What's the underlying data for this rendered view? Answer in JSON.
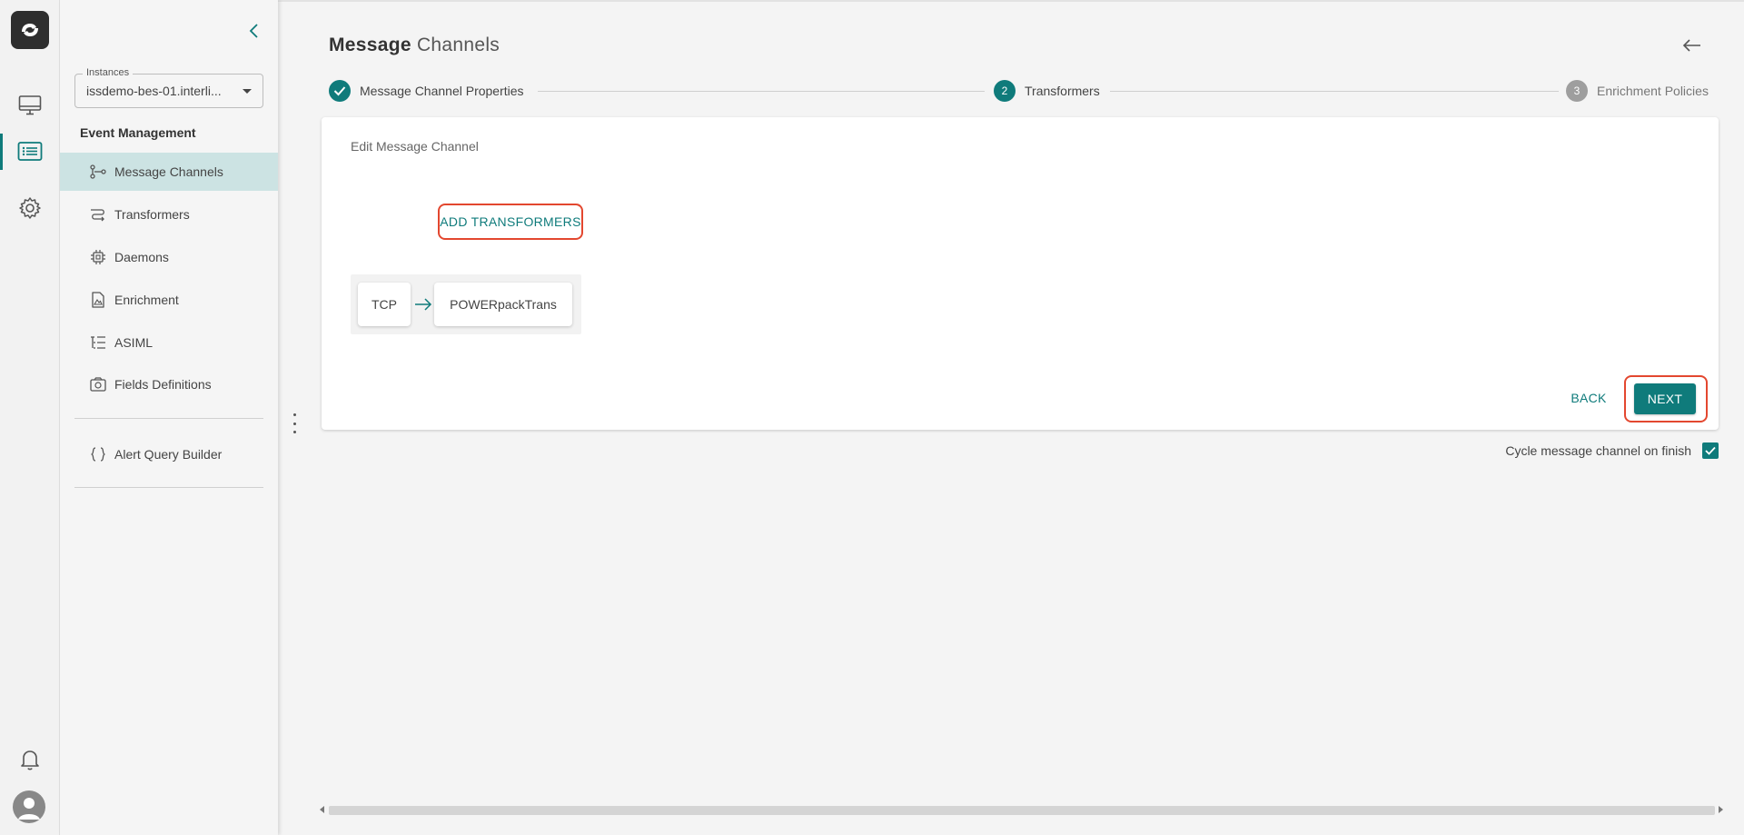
{
  "app": {
    "instance_label": "Instances",
    "instance_value": "issdemo-bes-01.interli..."
  },
  "sidebar": {
    "section_title": "Event Management",
    "items": [
      {
        "label": "Message Channels",
        "icon": "message-channels-icon",
        "active": true
      },
      {
        "label": "Transformers",
        "icon": "transformers-icon",
        "active": false
      },
      {
        "label": "Daemons",
        "icon": "daemons-icon",
        "active": false
      },
      {
        "label": "Enrichment",
        "icon": "enrichment-icon",
        "active": false
      },
      {
        "label": "ASIML",
        "icon": "asiml-icon",
        "active": false
      },
      {
        "label": "Fields Definitions",
        "icon": "fields-definitions-icon",
        "active": false
      }
    ],
    "extra_item": {
      "label": "Alert Query Builder",
      "icon": "braces-icon"
    }
  },
  "rail": {
    "items": [
      "monitor-icon",
      "list-icon",
      "gear-icon"
    ],
    "active": "list-icon",
    "bottom": [
      "bell-icon",
      "avatar"
    ]
  },
  "header": {
    "title_bold": "Message",
    "title_light": "Channels"
  },
  "stepper": {
    "steps": [
      {
        "number": "1",
        "label": "Message Channel Properties",
        "state": "completed"
      },
      {
        "number": "2",
        "label": "Transformers",
        "state": "active"
      },
      {
        "number": "3",
        "label": "Enrichment Policies",
        "state": "pending"
      }
    ]
  },
  "card": {
    "title": "Edit Message Channel",
    "add_button": "ADD TRANSFORMERS",
    "pipeline": [
      "TCP",
      "POWERpackTrans"
    ],
    "back_button": "BACK",
    "next_button": "NEXT"
  },
  "cycle": {
    "label": "Cycle message channel on finish",
    "checked": true
  },
  "colors": {
    "accent": "#0f7b7b",
    "highlight": "#e3472f",
    "active_nav_bg": "#cce3e3",
    "pending_step": "#9e9e9e"
  }
}
